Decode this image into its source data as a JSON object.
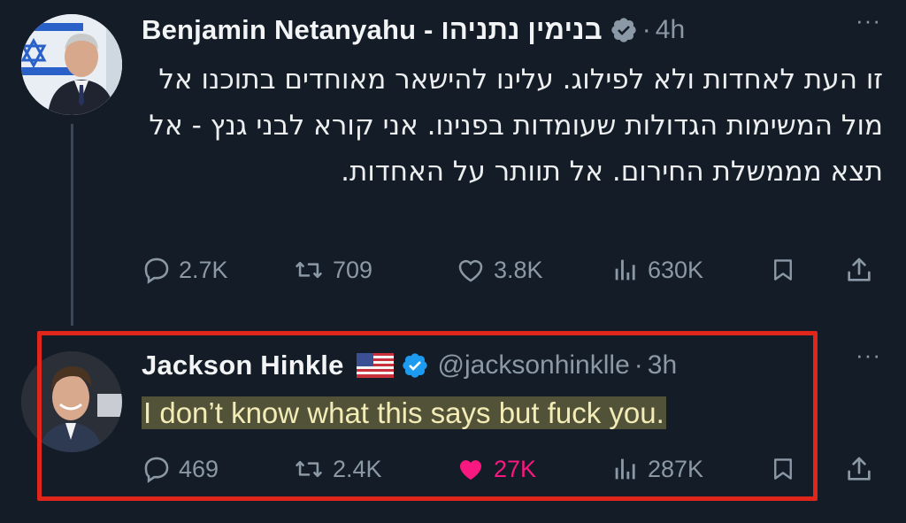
{
  "thread": [
    {
      "author": {
        "display_name": "Benjamin Netanyahu - בנימין נתניהו",
        "verified": true
      },
      "separator": "·",
      "time": "4h",
      "more_label": "···",
      "body": "זו העת לאחדות ולא לפילוג. עלינו להישאר מאוחדים בתוכנו אל מול המשימות הגדולות שעומדות בפנינו. אני קורא לבני גנץ - אל תצא מממשלת החירום. אל תוותר על האחדות.",
      "actions": {
        "replies": "2.7K",
        "reposts": "709",
        "likes": "3.8K",
        "views": "630K"
      }
    },
    {
      "author": {
        "display_name": "Jackson Hinkle",
        "handle": "@jacksonhinklle",
        "flag": "US flag",
        "verified": true
      },
      "separator": "·",
      "time": "3h",
      "more_label": "···",
      "body": "I don’t know what this says but fuck you.",
      "actions": {
        "replies": "469",
        "reposts": "2.4K",
        "likes": "27K",
        "views": "287K",
        "liked": true
      }
    }
  ],
  "icons": {
    "reply": "reply-icon",
    "repost": "repost-icon",
    "like": "heart-icon",
    "views": "views-icon",
    "bookmark": "bookmark-icon",
    "share": "share-icon",
    "verified": "verified-badge-icon"
  },
  "colors": {
    "background": "#15202b",
    "verified": "#1d9bf0",
    "liked": "#f91880",
    "highlight_border": "#e0261b",
    "secondary_text": "#8b98a5"
  }
}
